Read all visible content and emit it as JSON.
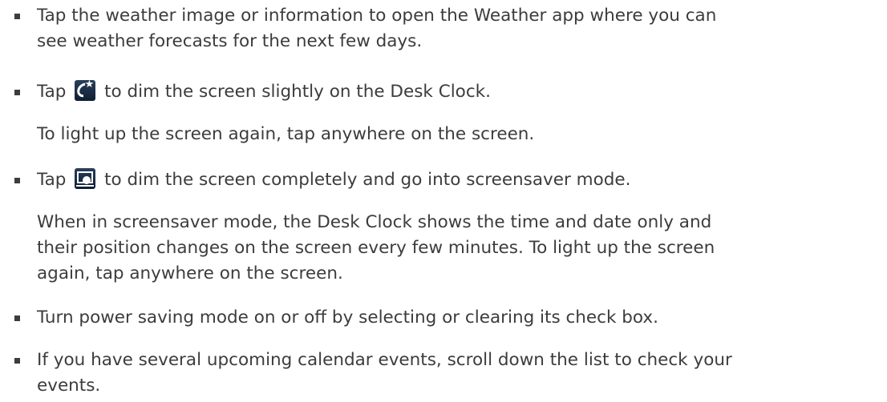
{
  "items": [
    {
      "lines": [
        "Tap the weather image or information to open the Weather app where you can",
        "see weather forecasts for the next few days."
      ]
    },
    {
      "before": "Tap ",
      "icon": "dim-screen-moon-icon",
      "after": " to dim the screen slightly on the Desk Clock.",
      "note": "To light up the screen again, tap anywhere on the screen."
    },
    {
      "before": "Tap ",
      "icon": "screensaver-icon",
      "after": " to dim the screen completely and go into screensaver mode.",
      "note_lines": [
        "When in screensaver mode, the Desk Clock shows the time and date only and",
        "their position changes on the screen every few minutes. To light up the screen",
        "again, tap anywhere on the screen."
      ]
    },
    {
      "lines": [
        "Turn power saving mode on or off by selecting or clearing its check box."
      ]
    },
    {
      "lines": [
        "If you have several upcoming calendar events, scroll down the list to check your",
        "events."
      ]
    }
  ],
  "colors": {
    "text": "#3c3c3c",
    "icon_bg": "#1b2c45"
  }
}
